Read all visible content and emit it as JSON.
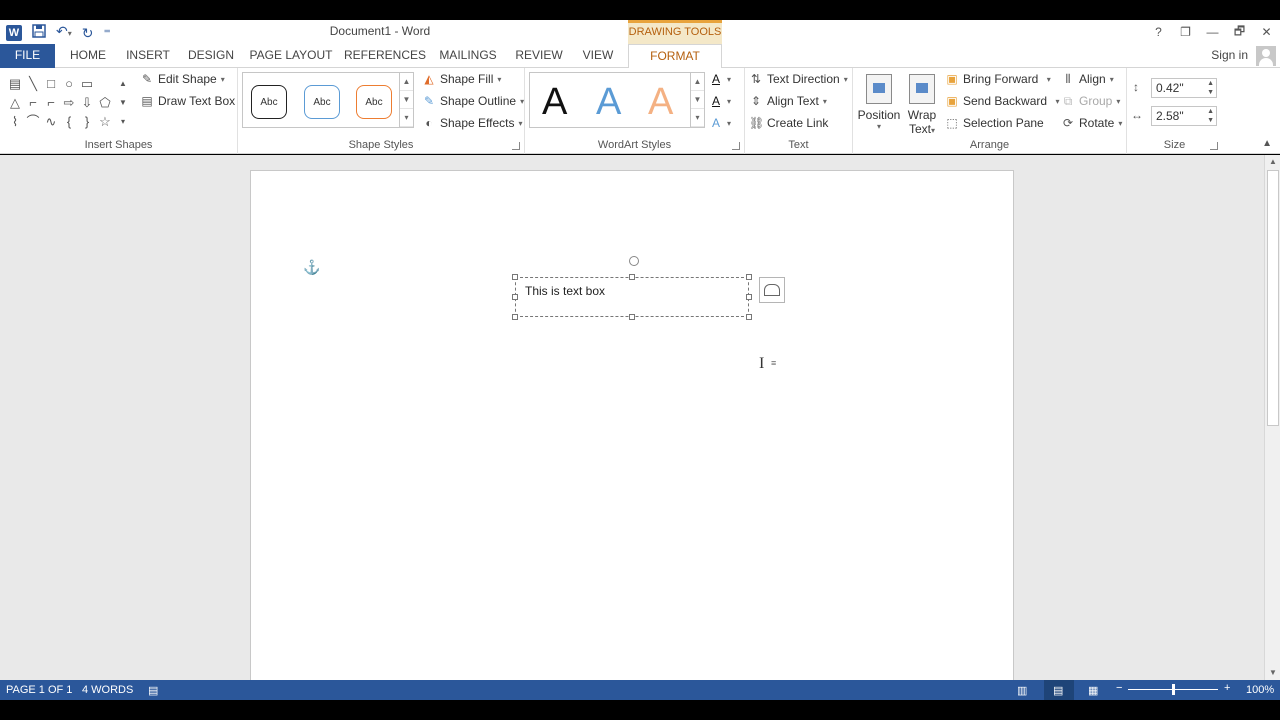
{
  "window": {
    "title": "Document1 - Word",
    "context_tab_header": "DRAWING TOOLS",
    "sign_in": "Sign in",
    "controls": [
      "?",
      "❐",
      "—",
      "🗗",
      "✕"
    ]
  },
  "qat": {
    "logo": "W",
    "customize": "⁼"
  },
  "tabs": [
    "FILE",
    "HOME",
    "INSERT",
    "DESIGN",
    "PAGE LAYOUT",
    "REFERENCES",
    "MAILINGS",
    "REVIEW",
    "VIEW",
    "FORMAT"
  ],
  "ribbon": {
    "insert_shapes": {
      "label": "Insert Shapes",
      "shapes": [
        "▤",
        "╲",
        "□",
        "○",
        "▭",
        "",
        "",
        " △",
        "⌐",
        "⌐",
        "⇨",
        "⇩",
        "⬠",
        "",
        "⌇",
        "⌒",
        "∿",
        "{",
        "}",
        "☆",
        ""
      ],
      "edit_shape": "Edit Shape",
      "draw_text_box": "Draw Text Box"
    },
    "shape_styles": {
      "label": "Shape Styles",
      "samples": [
        "Abc",
        "Abc",
        "Abc"
      ],
      "shape_fill": "Shape Fill",
      "shape_outline": "Shape Outline",
      "shape_effects": "Shape Effects"
    },
    "wordart_styles": {
      "label": "WordArt Styles",
      "samples": [
        "A",
        "A",
        "A"
      ]
    },
    "text": {
      "label": "Text",
      "text_direction": "Text Direction",
      "align_text": "Align Text",
      "create_link": "Create Link"
    },
    "arrange": {
      "label": "Arrange",
      "position": "Position",
      "wrap_text_line1": "Wrap",
      "wrap_text_line2": "Text",
      "bring_forward": "Bring Forward",
      "send_backward": "Send Backward",
      "selection_pane": "Selection Pane",
      "align": "Align",
      "group": "Group",
      "rotate": "Rotate"
    },
    "size": {
      "label": "Size",
      "height": "0.42\"",
      "width": "2.58\""
    }
  },
  "document": {
    "text_box_content": "This is text box"
  },
  "status": {
    "page": "PAGE 1 OF 1",
    "words": "4 WORDS",
    "zoom": "100%",
    "zoom_level": 0.5
  },
  "colors": {
    "accent": "#2b579a",
    "context": "#b5600f"
  }
}
